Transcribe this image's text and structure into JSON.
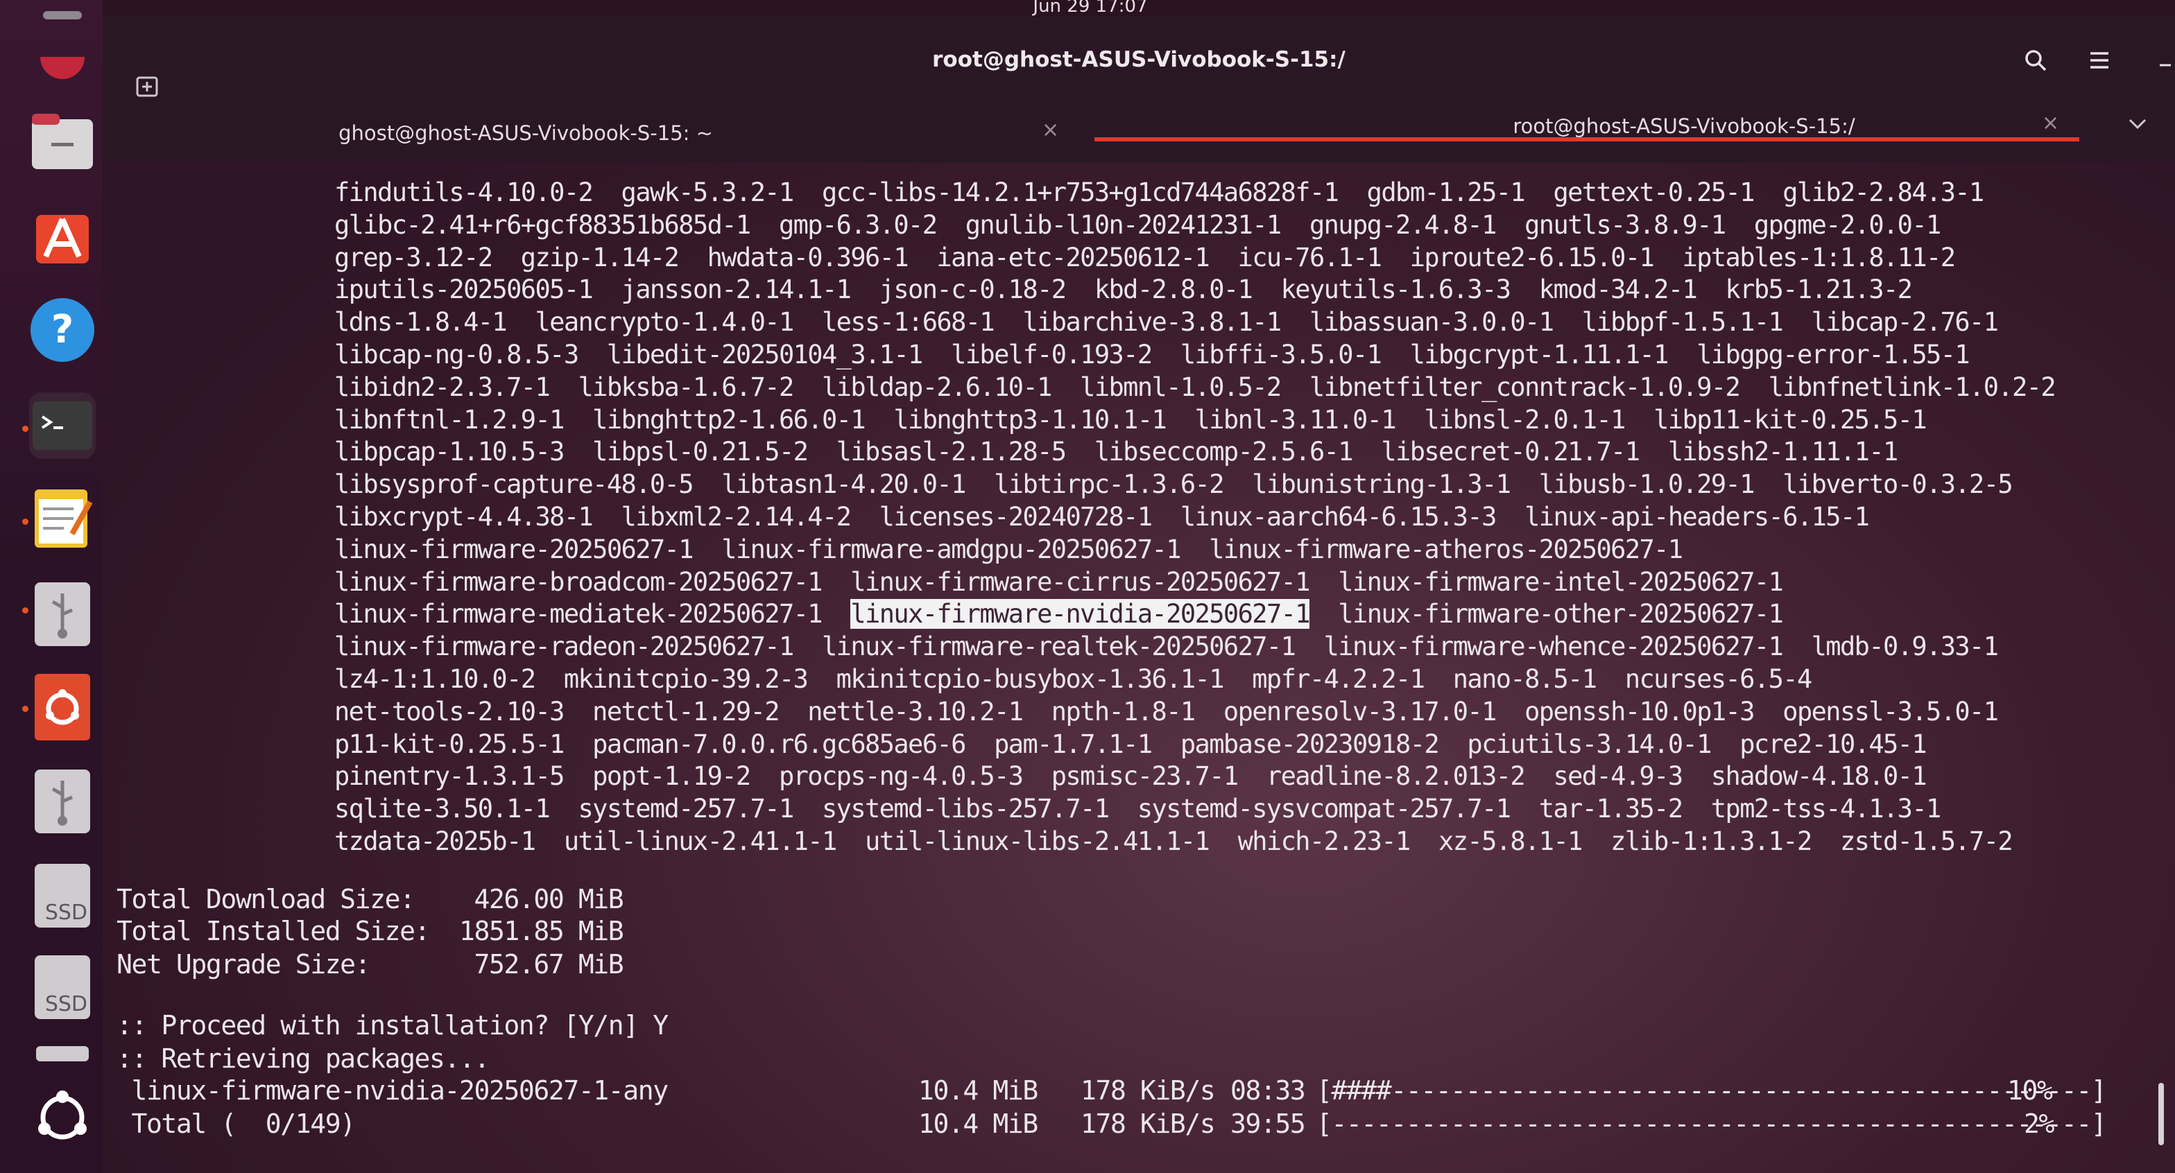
{
  "topbar": {
    "clock": "Jun 29  17:07"
  },
  "window": {
    "title": "root@ghost-ASUS-Vivobook-S-15:/"
  },
  "tabs": [
    {
      "label": "ghost@ghost-ASUS-Vivobook-S-15: ~",
      "close": "×"
    },
    {
      "label": "root@ghost-ASUS-Vivobook-S-15:/",
      "close": "×"
    }
  ],
  "dock": [
    "Firefox",
    "Files",
    "App Center",
    "Help",
    "Terminal",
    "Text Editor",
    "USB Drive",
    "Startup Disk Creator",
    "USB Drive",
    "SSD",
    "SSD",
    "Drive",
    "Show Apps"
  ],
  "dock_labels": {
    "ssd1": "SSD",
    "ssd2": "SSD"
  },
  "terminal": {
    "package_lines": [
      {
        "before": "findutils-4.10.0-2  gawk-5.3.2-1  gcc-libs-14.2.1+r753+g1cd744a6828f-1  gdbm-1.25-1  gettext-0.25-1  glib2-2.84.3-1",
        "highlight": "",
        "after": ""
      },
      {
        "before": "glibc-2.41+r6+gcf88351b685d-1  gmp-6.3.0-2  gnulib-l10n-20241231-1  gnupg-2.4.8-1  gnutls-3.8.9-1  gpgme-2.0.0-1",
        "highlight": "",
        "after": ""
      },
      {
        "before": "grep-3.12-2  gzip-1.14-2  hwdata-0.396-1  iana-etc-20250612-1  icu-76.1-1  iproute2-6.15.0-1  iptables-1:1.8.11-2",
        "highlight": "",
        "after": ""
      },
      {
        "before": "iputils-20250605-1  jansson-2.14.1-1  json-c-0.18-2  kbd-2.8.0-1  keyutils-1.6.3-3  kmod-34.2-1  krb5-1.21.3-2",
        "highlight": "",
        "after": ""
      },
      {
        "before": "ldns-1.8.4-1  leancrypto-1.4.0-1  less-1:668-1  libarchive-3.8.1-1  libassuan-3.0.0-1  libbpf-1.5.1-1  libcap-2.76-1",
        "highlight": "",
        "after": ""
      },
      {
        "before": "libcap-ng-0.8.5-3  libedit-20250104_3.1-1  libelf-0.193-2  libffi-3.5.0-1  libgcrypt-1.11.1-1  libgpg-error-1.55-1",
        "highlight": "",
        "after": ""
      },
      {
        "before": "libidn2-2.3.7-1  libksba-1.6.7-2  libldap-2.6.10-1  libmnl-1.0.5-2  libnetfilter_conntrack-1.0.9-2  libnfnetlink-1.0.2-2",
        "highlight": "",
        "after": ""
      },
      {
        "before": "libnftnl-1.2.9-1  libnghttp2-1.66.0-1  libnghttp3-1.10.1-1  libnl-3.11.0-1  libnsl-2.0.1-1  libp11-kit-0.25.5-1",
        "highlight": "",
        "after": ""
      },
      {
        "before": "libpcap-1.10.5-3  libpsl-0.21.5-2  libsasl-2.1.28-5  libseccomp-2.5.6-1  libsecret-0.21.7-1  libssh2-1.11.1-1",
        "highlight": "",
        "after": ""
      },
      {
        "before": "libsysprof-capture-48.0-5  libtasn1-4.20.0-1  libtirpc-1.3.6-2  libunistring-1.3-1  libusb-1.0.29-1  libverto-0.3.2-5",
        "highlight": "",
        "after": ""
      },
      {
        "before": "libxcrypt-4.4.38-1  libxml2-2.14.4-2  licenses-20240728-1  linux-aarch64-6.15.3-3  linux-api-headers-6.15-1",
        "highlight": "",
        "after": ""
      },
      {
        "before": "linux-firmware-20250627-1  linux-firmware-amdgpu-20250627-1  linux-firmware-atheros-20250627-1",
        "highlight": "",
        "after": ""
      },
      {
        "before": "linux-firmware-broadcom-20250627-1  linux-firmware-cirrus-20250627-1  linux-firmware-intel-20250627-1",
        "highlight": "",
        "after": ""
      },
      {
        "before": "linux-firmware-mediatek-20250627-1  ",
        "highlight": "linux-firmware-nvidia-20250627-1",
        "after": "  linux-firmware-other-20250627-1"
      },
      {
        "before": "linux-firmware-radeon-20250627-1  linux-firmware-realtek-20250627-1  linux-firmware-whence-20250627-1  lmdb-0.9.33-1",
        "highlight": "",
        "after": ""
      },
      {
        "before": "lz4-1:1.10.0-2  mkinitcpio-39.2-3  mkinitcpio-busybox-1.36.1-1  mpfr-4.2.2-1  nano-8.5-1  ncurses-6.5-4",
        "highlight": "",
        "after": ""
      },
      {
        "before": "net-tools-2.10-3  netctl-1.29-2  nettle-3.10.2-1  npth-1.8-1  openresolv-3.17.0-1  openssh-10.0p1-3  openssl-3.5.0-1",
        "highlight": "",
        "after": ""
      },
      {
        "before": "p11-kit-0.25.5-1  pacman-7.0.0.r6.gc685ae6-6  pam-1.7.1-1  pambase-20230918-2  pciutils-3.14.0-1  pcre2-10.45-1",
        "highlight": "",
        "after": ""
      },
      {
        "before": "pinentry-1.3.1-5  popt-1.19-2  procps-ng-4.0.5-3  psmisc-23.7-1  readline-8.2.013-2  sed-4.9-3  shadow-4.18.0-1",
        "highlight": "",
        "after": ""
      },
      {
        "before": "sqlite-3.50.1-1  systemd-257.7-1  systemd-libs-257.7-1  systemd-sysvcompat-257.7-1  tar-1.35-2  tpm2-tss-4.1.3-1",
        "highlight": "",
        "after": ""
      },
      {
        "before": "tzdata-2025b-1  util-linux-2.41.1-1  util-linux-libs-2.41.1-1  which-2.23-1  xz-5.8.1-1  zlib-1:1.3.1-2  zstd-1.5.7-2",
        "highlight": "",
        "after": ""
      }
    ],
    "summary": [
      "Total Download Size:    426.00 MiB",
      "Total Installed Size:  1851.85 MiB",
      "Net Upgrade Size:       752.67 MiB"
    ],
    "prompt": ":: Proceed with installation? [Y/n] Y",
    "retrieving": ":: Retrieving packages...",
    "downloads": [
      {
        "name": " linux-firmware-nvidia-20250627-1-any",
        "size": "10.4 MiB",
        "rate": "178 KiB/s",
        "eta": "08:33",
        "bar": "[####-----------------------------------------------]",
        "percent": "10%"
      },
      {
        "name": " Total (  0/149)",
        "size": "10.4 MiB",
        "rate": "178 KiB/s",
        "eta": "39:55",
        "bar": "[---------------------------------------------------]",
        "percent": "2%"
      }
    ]
  }
}
